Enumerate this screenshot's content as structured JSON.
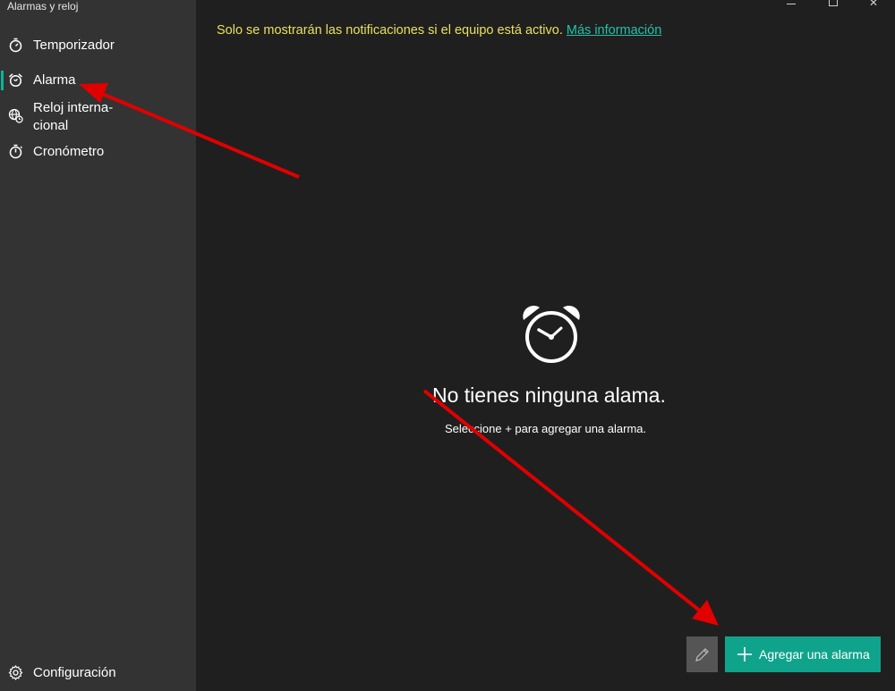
{
  "window": {
    "title": "Alarmas y reloj"
  },
  "sidebar": {
    "items": [
      {
        "label": "Temporizador",
        "icon": "timer-icon"
      },
      {
        "label": "Alarma",
        "icon": "alarm-clock-icon",
        "active": true
      },
      {
        "label": "Reloj interna-\ncional",
        "icon": "world-clock-icon"
      },
      {
        "label": "Cronómetro",
        "icon": "stopwatch-icon"
      }
    ],
    "settings_label": "Configuración"
  },
  "main": {
    "notice_text": "Solo se mostrarán las notificaciones si el equipo está activo.",
    "notice_link": "Más información",
    "empty_title": "No tienes ninguna alama.",
    "empty_subtitle": "Seleccione + para agregar una alarma.",
    "add_button_label": "Agregar una alarma"
  },
  "colors": {
    "accent": "#10a38c",
    "notice": "#e8e05b",
    "link": "#22c3a6",
    "annotation_arrow": "#e00000"
  }
}
